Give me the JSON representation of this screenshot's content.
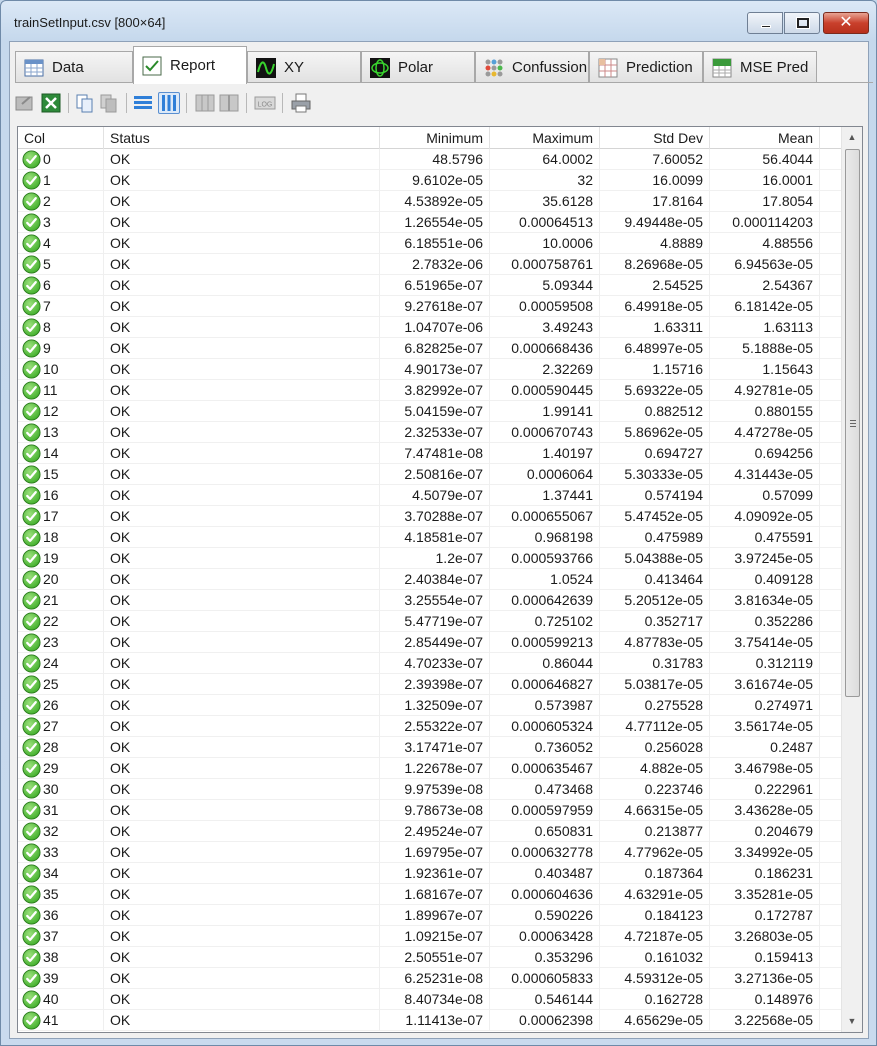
{
  "window": {
    "title": "trainSetInput.csv [800×64]"
  },
  "tabs": [
    {
      "label": "Data",
      "icon": "table-icon"
    },
    {
      "label": "Report",
      "icon": "checkmark-icon"
    },
    {
      "label": "XY",
      "icon": "waveform-icon"
    },
    {
      "label": "Polar",
      "icon": "polar-icon"
    },
    {
      "label": "Confussion",
      "icon": "dots-grid-icon"
    },
    {
      "label": "Prediction",
      "icon": "grid-icon"
    },
    {
      "label": "MSE Pred",
      "icon": "mse-icon"
    }
  ],
  "active_tab": "Report",
  "toolbar": {
    "icons": [
      "export-icon",
      "excel-icon",
      "copy-icon",
      "copy-image-icon",
      "rows-view-icon",
      "columns-view-icon",
      "split-view-icon",
      "split-view-alt-icon",
      "log-icon",
      "print-icon"
    ],
    "log_label": "LOG"
  },
  "table": {
    "headers": [
      "Col",
      "Status",
      "Minimum",
      "Maximum",
      "Std Dev",
      "Mean"
    ],
    "rows": [
      [
        "0",
        "OK",
        "48.5796",
        "64.0002",
        "7.60052",
        "56.4044"
      ],
      [
        "1",
        "OK",
        "9.6102e-05",
        "32",
        "16.0099",
        "16.0001"
      ],
      [
        "2",
        "OK",
        "4.53892e-05",
        "35.6128",
        "17.8164",
        "17.8054"
      ],
      [
        "3",
        "OK",
        "1.26554e-05",
        "0.00064513",
        "9.49448e-05",
        "0.000114203"
      ],
      [
        "4",
        "OK",
        "6.18551e-06",
        "10.0006",
        "4.8889",
        "4.88556"
      ],
      [
        "5",
        "OK",
        "2.7832e-06",
        "0.000758761",
        "8.26968e-05",
        "6.94563e-05"
      ],
      [
        "6",
        "OK",
        "6.51965e-07",
        "5.09344",
        "2.54525",
        "2.54367"
      ],
      [
        "7",
        "OK",
        "9.27618e-07",
        "0.00059508",
        "6.49918e-05",
        "6.18142e-05"
      ],
      [
        "8",
        "OK",
        "1.04707e-06",
        "3.49243",
        "1.63311",
        "1.63113"
      ],
      [
        "9",
        "OK",
        "6.82825e-07",
        "0.000668436",
        "6.48997e-05",
        "5.1888e-05"
      ],
      [
        "10",
        "OK",
        "4.90173e-07",
        "2.32269",
        "1.15716",
        "1.15643"
      ],
      [
        "11",
        "OK",
        "3.82992e-07",
        "0.000590445",
        "5.69322e-05",
        "4.92781e-05"
      ],
      [
        "12",
        "OK",
        "5.04159e-07",
        "1.99141",
        "0.882512",
        "0.880155"
      ],
      [
        "13",
        "OK",
        "2.32533e-07",
        "0.000670743",
        "5.86962e-05",
        "4.47278e-05"
      ],
      [
        "14",
        "OK",
        "7.47481e-08",
        "1.40197",
        "0.694727",
        "0.694256"
      ],
      [
        "15",
        "OK",
        "2.50816e-07",
        "0.0006064",
        "5.30333e-05",
        "4.31443e-05"
      ],
      [
        "16",
        "OK",
        "4.5079e-07",
        "1.37441",
        "0.574194",
        "0.57099"
      ],
      [
        "17",
        "OK",
        "3.70288e-07",
        "0.000655067",
        "5.47452e-05",
        "4.09092e-05"
      ],
      [
        "18",
        "OK",
        "4.18581e-07",
        "0.968198",
        "0.475989",
        "0.475591"
      ],
      [
        "19",
        "OK",
        "1.2e-07",
        "0.000593766",
        "5.04388e-05",
        "3.97245e-05"
      ],
      [
        "20",
        "OK",
        "2.40384e-07",
        "1.0524",
        "0.413464",
        "0.409128"
      ],
      [
        "21",
        "OK",
        "3.25554e-07",
        "0.000642639",
        "5.20512e-05",
        "3.81634e-05"
      ],
      [
        "22",
        "OK",
        "5.47719e-07",
        "0.725102",
        "0.352717",
        "0.352286"
      ],
      [
        "23",
        "OK",
        "2.85449e-07",
        "0.000599213",
        "4.87783e-05",
        "3.75414e-05"
      ],
      [
        "24",
        "OK",
        "4.70233e-07",
        "0.86044",
        "0.31783",
        "0.312119"
      ],
      [
        "25",
        "OK",
        "2.39398e-07",
        "0.000646827",
        "5.03817e-05",
        "3.61674e-05"
      ],
      [
        "26",
        "OK",
        "1.32509e-07",
        "0.573987",
        "0.275528",
        "0.274971"
      ],
      [
        "27",
        "OK",
        "2.55322e-07",
        "0.000605324",
        "4.77112e-05",
        "3.56174e-05"
      ],
      [
        "28",
        "OK",
        "3.17471e-07",
        "0.736052",
        "0.256028",
        "0.2487"
      ],
      [
        "29",
        "OK",
        "1.22678e-07",
        "0.000635467",
        "4.882e-05",
        "3.46798e-05"
      ],
      [
        "30",
        "OK",
        "9.97539e-08",
        "0.473468",
        "0.223746",
        "0.222961"
      ],
      [
        "31",
        "OK",
        "9.78673e-08",
        "0.000597959",
        "4.66315e-05",
        "3.43628e-05"
      ],
      [
        "32",
        "OK",
        "2.49524e-07",
        "0.650831",
        "0.213877",
        "0.204679"
      ],
      [
        "33",
        "OK",
        "1.69795e-07",
        "0.000632778",
        "4.77962e-05",
        "3.34992e-05"
      ],
      [
        "34",
        "OK",
        "1.92361e-07",
        "0.403487",
        "0.187364",
        "0.186231"
      ],
      [
        "35",
        "OK",
        "1.68167e-07",
        "0.000604636",
        "4.63291e-05",
        "3.35281e-05"
      ],
      [
        "36",
        "OK",
        "1.89967e-07",
        "0.590226",
        "0.184123",
        "0.172787"
      ],
      [
        "37",
        "OK",
        "1.09215e-07",
        "0.00063428",
        "4.72187e-05",
        "3.26803e-05"
      ],
      [
        "38",
        "OK",
        "2.50551e-07",
        "0.353296",
        "0.161032",
        "0.159413"
      ],
      [
        "39",
        "OK",
        "6.25231e-08",
        "0.000605833",
        "4.59312e-05",
        "3.27136e-05"
      ],
      [
        "40",
        "OK",
        "8.40734e-08",
        "0.546144",
        "0.162728",
        "0.148976"
      ],
      [
        "41",
        "OK",
        "1.11413e-07",
        "0.00062398",
        "4.65629e-05",
        "3.22568e-05"
      ]
    ]
  },
  "colors": {
    "ok_green": "#3fae29",
    "selection_blue": "#2f7fd8"
  }
}
